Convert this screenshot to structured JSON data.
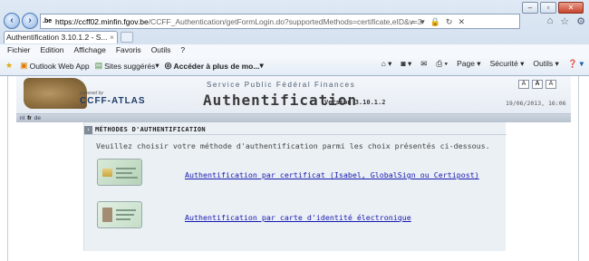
{
  "browser": {
    "url_host": "https://ccff02.minfin.fgov.be",
    "url_path": "/CCFF_Authentication/getFormLogin.do?supportedMethods=certificate,eID&v=3",
    "favicon_text": ".be",
    "tab_title": "Authentification 3.10.1.2 - S...",
    "menu": [
      "Fichier",
      "Edition",
      "Affichage",
      "Favoris",
      "Outils",
      "?"
    ],
    "favorites": [
      "Outlook Web App",
      "Sites suggérés",
      "Accéder à plus de mo..."
    ],
    "commands": [
      "Page",
      "Sécurité",
      "Outils"
    ]
  },
  "page": {
    "powered_by": "powered by",
    "logo_text": "CCFF-ATLAS",
    "service": "Service Public Fédéral Finances",
    "title": "Authentification",
    "version": "Version 3.10.1.2",
    "datetime": "19/06/2013, 16:06",
    "font_sizes": [
      "A",
      "A",
      "A"
    ],
    "languages": [
      "nl",
      "fr",
      "de"
    ],
    "selected_language": "fr",
    "section_title": "MÉTHODES D'AUTHENTIFICATION",
    "intro": "Veuillez choisir votre méthode d'authentification parmi les choix présentés ci-dessous.",
    "methods": [
      {
        "label": "Authentification par certificat (Isabel, GlobalSign ou Certipost)"
      },
      {
        "label": "Authentification par carte d'identité électronique"
      }
    ]
  }
}
